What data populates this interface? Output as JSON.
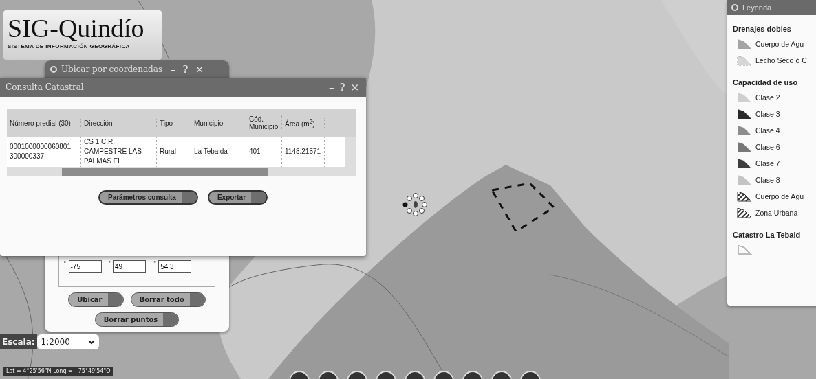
{
  "logo": {
    "title": "SIG-Quindío",
    "subtitle": "SISTEMA DE INFORMACIÓN GEOGRÁFICA"
  },
  "locate_window": {
    "title": "Ubicar por coordenadas",
    "controls": [
      "–",
      "?",
      "×"
    ],
    "fields": [
      {
        "unit": "°",
        "value": "-75"
      },
      {
        "unit": "'",
        "value": "49"
      },
      {
        "unit": "\"",
        "value": "54.3"
      }
    ],
    "buttons": [
      "Ubicar",
      "Borrar todo",
      "Borrar puntos"
    ]
  },
  "cadastre_window": {
    "title": "Consulta Catastral",
    "controls": [
      "–",
      "?",
      "×"
    ],
    "table": {
      "columns": [
        "Número predial (30)",
        "Dirección",
        "Tipo",
        "Municipio",
        "Cód. Municipio",
        "Área (m$^{2}$)"
      ],
      "rows": [
        [
          "0001000000060801 300000337",
          "CS 1 C.R. CAMPESTRE LAS PALMAS EL",
          "Rural",
          "La Tebaida",
          "401",
          "1148.21571"
        ]
      ]
    },
    "buttons": [
      "Parámetros consulta",
      "Exportar"
    ]
  },
  "scale": {
    "label": "Escala:",
    "value": "1:2000"
  },
  "coordinates": "Lat = 4°25'56\"N Long = - 75°49'54\"O",
  "legend": {
    "title": "Leyenda",
    "groups": [
      {
        "title": "Drenajes dobles",
        "items": [
          {
            "label": "Cuerpo de Agu",
            "kind": "fill",
            "color": "#a4a4a4"
          },
          {
            "label": "Lecho Seco ó C",
            "kind": "dotted",
            "color": "#d6d6d6"
          }
        ]
      },
      {
        "title": "Capacidad de uso",
        "items": [
          {
            "label": "Clase 2",
            "kind": "fill",
            "color": "#cfcfcf"
          },
          {
            "label": "Clase 3",
            "kind": "fill",
            "color": "#2a2a2a"
          },
          {
            "label": "Clase 4",
            "kind": "fill",
            "color": "#8c8c8c"
          },
          {
            "label": "Clase 6",
            "kind": "fill",
            "color": "#777777"
          },
          {
            "label": "Clase 7",
            "kind": "fill",
            "color": "#3e3e3e"
          },
          {
            "label": "Clase 8",
            "kind": "fill",
            "color": "#c4c4c4"
          },
          {
            "label": "Cuerpo de Agu",
            "kind": "hatch",
            "color": "#333333"
          },
          {
            "label": "Zona Urbana",
            "kind": "hatch",
            "color": "#333333"
          }
        ]
      },
      {
        "title": "Catastro La Tebaid",
        "items": [
          {
            "kind": "outline",
            "color": "#bbbbbb"
          }
        ]
      }
    ]
  }
}
